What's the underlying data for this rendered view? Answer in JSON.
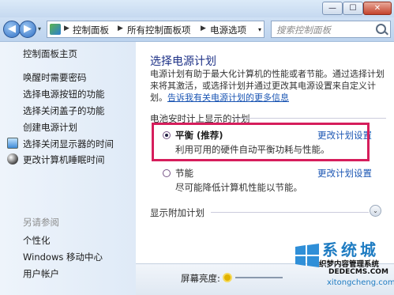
{
  "window": {
    "min": "—",
    "max": "☐",
    "close": "✕"
  },
  "nav": {
    "back": "◀",
    "forward": "▶",
    "dropdown": "▾",
    "refresh": "↻"
  },
  "address": {
    "breadcrumbs": [
      "控制面板",
      "所有控制面板项",
      "电源选项"
    ],
    "separator": "▶"
  },
  "search": {
    "placeholder": "搜索控制面板"
  },
  "sidebar": {
    "home": "控制面板主页",
    "items": [
      {
        "label": "唤醒时需要密码"
      },
      {
        "label": "选择电源按钮的功能"
      },
      {
        "label": "选择关闭盖子的功能"
      },
      {
        "label": "创建电源计划"
      },
      {
        "label": "选择关闭显示器的时间",
        "icon": "display-icon"
      },
      {
        "label": "更改计算机睡眠时间",
        "icon": "moon-icon"
      }
    ],
    "see_also_heading": "另请参阅",
    "see_also": [
      {
        "label": "个性化"
      },
      {
        "label": "Windows 移动中心"
      },
      {
        "label": "用户帐户"
      }
    ]
  },
  "main": {
    "title": "选择电源计划",
    "desc_text": "电源计划有助于最大化计算机的性能或者节能。通过选择计划来将其激活，或选择计划并通过更改其电源设置来自定义计划。",
    "desc_link": "告诉我有关电源计划的更多信息",
    "group_heading": "电池安时计上显示的计划",
    "plans": [
      {
        "name": "平衡 (推荐)",
        "desc": "利用可用的硬件自动平衡功耗与性能。",
        "link": "更改计划设置",
        "selected": true
      },
      {
        "name": "节能",
        "desc": "尽可能降低计算机性能以节能。",
        "link": "更改计划设置",
        "selected": false
      }
    ],
    "more_plans": "显示附加计划",
    "expand_glyph": "⌄"
  },
  "status": {
    "brightness_label": "屏幕亮度:"
  },
  "watermark": {
    "title": "系统城",
    "line1": "织梦内容管理系统",
    "line2": "DEDECMS.COM",
    "site": "xitongcheng.com"
  },
  "colors": {
    "highlight": "#d61e5c",
    "link": "#1a55b3",
    "title": "#1e3287"
  }
}
